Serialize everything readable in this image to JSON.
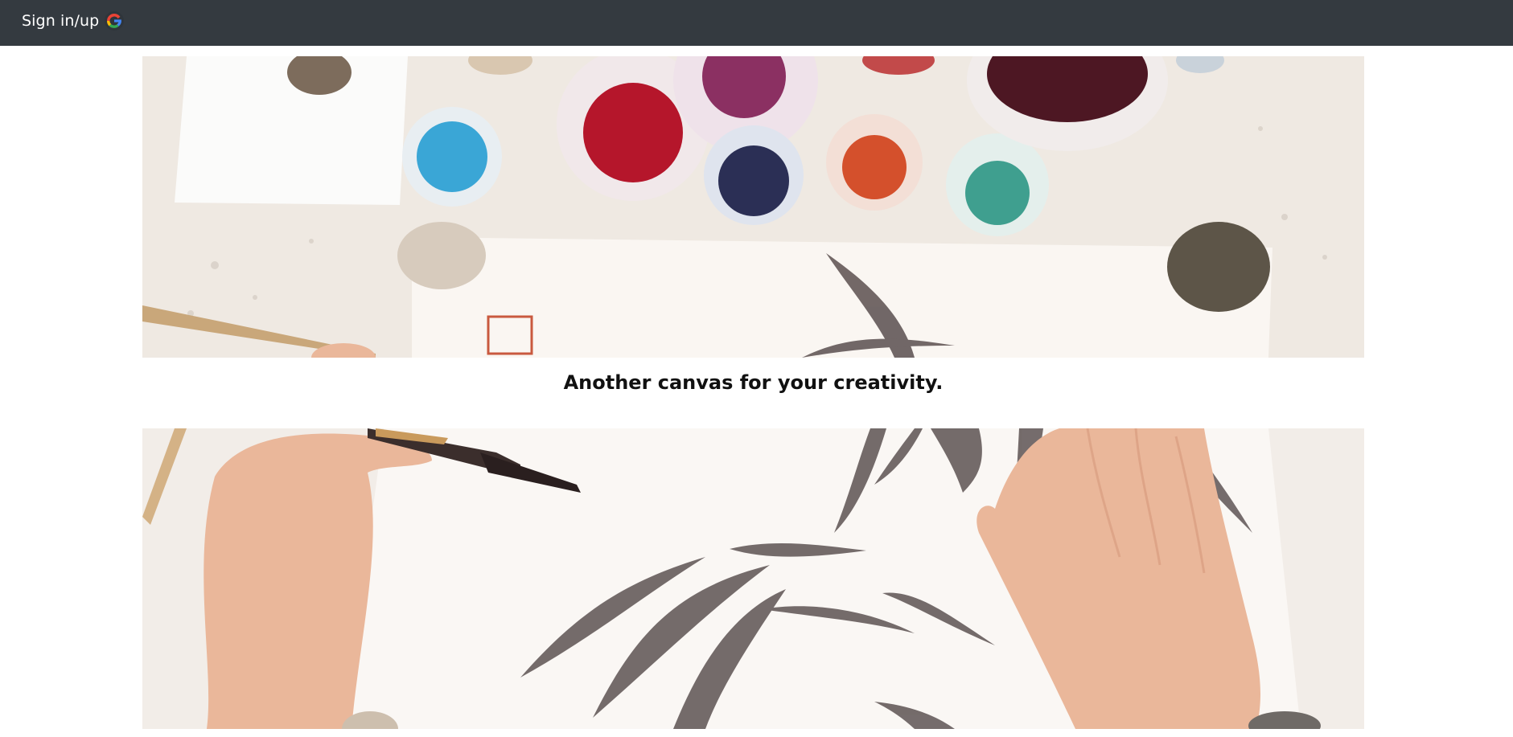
{
  "navbar": {
    "signin_label": "Sign in/up",
    "signin_icon": "google-g-icon",
    "background": "#343a40"
  },
  "hero_top": {
    "icon": "paint-bowls-photo"
  },
  "tagline": {
    "text": "Another canvas for your creativity."
  },
  "hero_bottom": {
    "icon": "bamboo-ink-painting-photo"
  },
  "colors": {
    "paper": "#f6f1ec",
    "ink": "#4a4242",
    "crimson": "#b5162b",
    "blue": "#3aa6d6",
    "navy": "#2b2f55",
    "orange": "#d4502c",
    "teal": "#3f9f8f",
    "skin": "#eab79a"
  }
}
